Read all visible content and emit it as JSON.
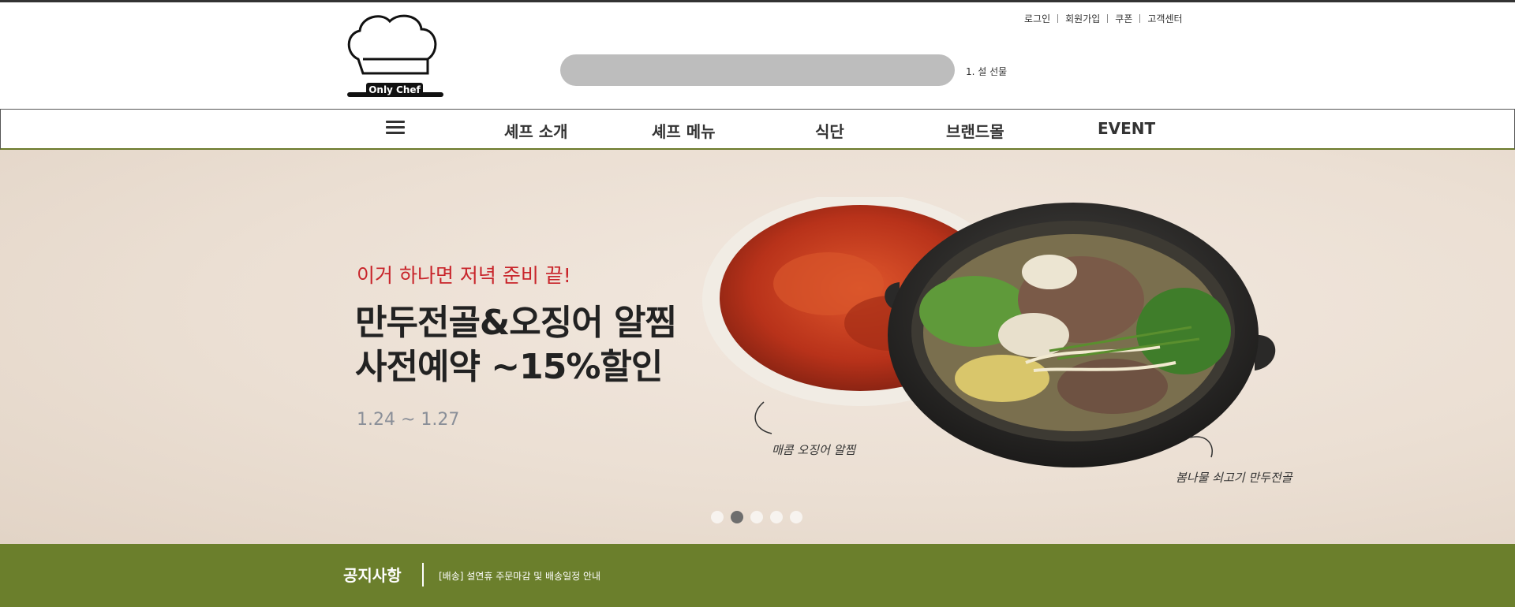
{
  "header": {
    "logo_text": "Only Chef",
    "util_links": [
      "로그인",
      "회원가입",
      "쿠폰",
      "고객센터"
    ],
    "search_placeholder": "",
    "rank_text": "1. 설 선물"
  },
  "nav": {
    "menu_icon": "hamburger-icon",
    "items": [
      "셰프 소개",
      "셰프 메뉴",
      "식단",
      "브랜드몰",
      "EVENT"
    ]
  },
  "banner": {
    "subtitle": "이거 하나면 저녁 준비 끝!",
    "title_line1": "만두전골&오징어 알찜",
    "title_line2": "사전예약 ~15%할인",
    "date": "1.24 ~ 1.27",
    "caption_left": "매콤 오징어 알찜",
    "caption_right": "봄나물 쇠고기 만두전골",
    "slides": 5,
    "active_slide": 2
  },
  "notice": {
    "title": "공지사항",
    "text": "[배송] 설연휴 주문마감 및 배송일정 안내"
  },
  "colors": {
    "accent_red": "#c8242a",
    "notice_green": "#6b7f2c",
    "banner_bg": "#ebdfd3"
  }
}
